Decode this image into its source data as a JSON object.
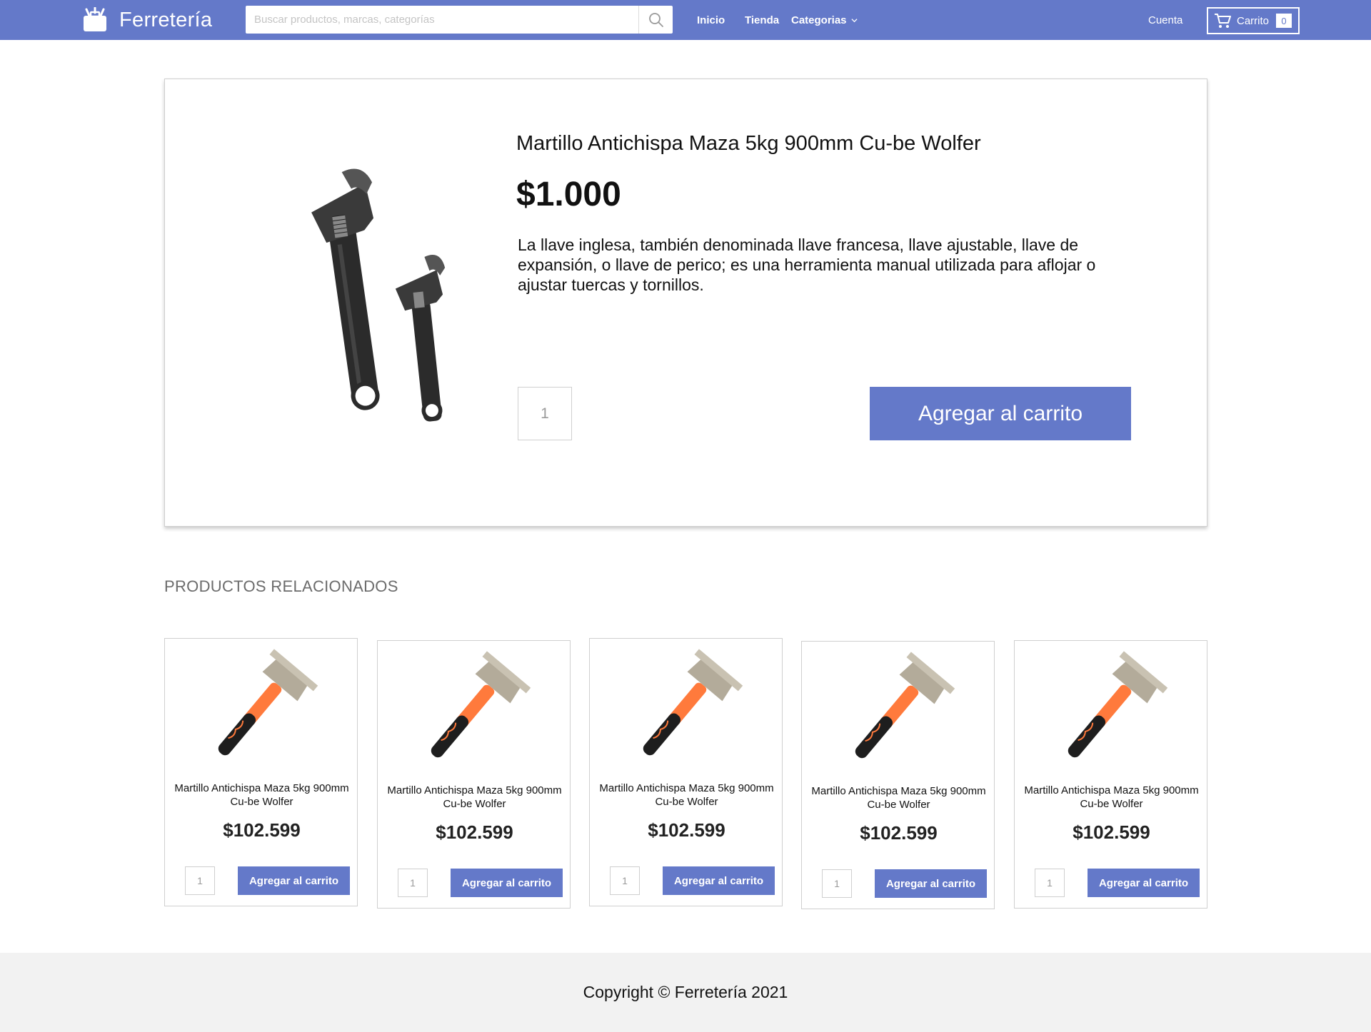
{
  "header": {
    "brand": "Ferretería",
    "search_placeholder": "Buscar productos, marcas, categorías",
    "nav": {
      "inicio": "Inicio",
      "tienda": "Tienda",
      "categorias": "Categorias"
    },
    "account": "Cuenta",
    "cart_label": "Carrito",
    "cart_count": "0",
    "color": "#6479c9"
  },
  "product": {
    "title": "Martillo Antichispa Maza 5kg 900mm Cu-be Wolfer",
    "price": "$1.000",
    "description": "La llave inglesa, también denominada llave francesa, llave ajustable, llave de expansión, o llave de perico; es una herramienta manual utilizada para aflojar o ajustar tuercas y tornillos.",
    "quantity": "1",
    "add_button": "Agregar al carrito",
    "image_icon": "adjustable-wrench-icon"
  },
  "related": {
    "title": "PRODUCTOS RELACIONADOS",
    "items": [
      {
        "name": "Martillo Antichispa Maza 5kg 900mm Cu-be Wolfer",
        "price": "$102.599",
        "quantity": "1",
        "add_button": "Agregar al carrito"
      },
      {
        "name": "Martillo Antichispa Maza 5kg 900mm Cu-be Wolfer",
        "price": "$102.599",
        "quantity": "1",
        "add_button": "Agregar al carrito"
      },
      {
        "name": "Martillo Antichispa Maza 5kg 900mm Cu-be Wolfer",
        "price": "$102.599",
        "quantity": "1",
        "add_button": "Agregar al carrito"
      },
      {
        "name": "Martillo Antichispa Maza 5kg 900mm Cu-be Wolfer",
        "price": "$102.599",
        "quantity": "1",
        "add_button": "Agregar al carrito"
      },
      {
        "name": "Martillo Antichispa Maza 5kg 900mm Cu-be Wolfer",
        "price": "$102.599",
        "quantity": "1",
        "add_button": "Agregar al carrito"
      }
    ]
  },
  "footer": {
    "copyright": "Copyright © Ferretería 2021"
  }
}
